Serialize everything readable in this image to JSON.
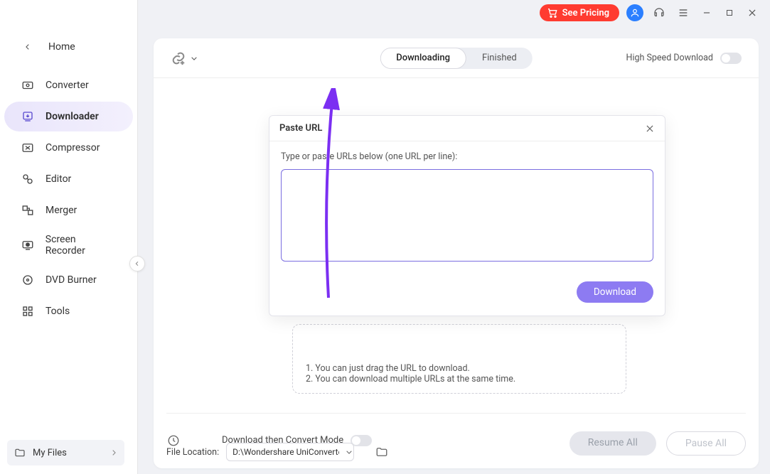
{
  "titlebar": {
    "pricing_label": "See Pricing"
  },
  "sidebar": {
    "back_label": "Home",
    "items": [
      "Converter",
      "Downloader",
      "Compressor",
      "Editor",
      "Merger",
      "Screen Recorder",
      "DVD Burner",
      "Tools"
    ],
    "active_index": 1,
    "my_files_label": "My Files"
  },
  "tabs": {
    "downloading": "Downloading",
    "finished": "Finished"
  },
  "high_speed_label": "High Speed Download",
  "hints": {
    "line1": "1. You can just drag the URL to download.",
    "line2": "2. You can download multiple URLs at the same time."
  },
  "convert_mode_label": "Download then Convert Mode",
  "file_location_label": "File Location:",
  "file_location_value": "D:\\Wondershare UniConverter",
  "resume_label": "Resume All",
  "pause_label": "Pause All",
  "modal": {
    "title": "Paste URL",
    "instruction": "Type or paste URLs below (one URL per line):",
    "download_label": "Download"
  }
}
